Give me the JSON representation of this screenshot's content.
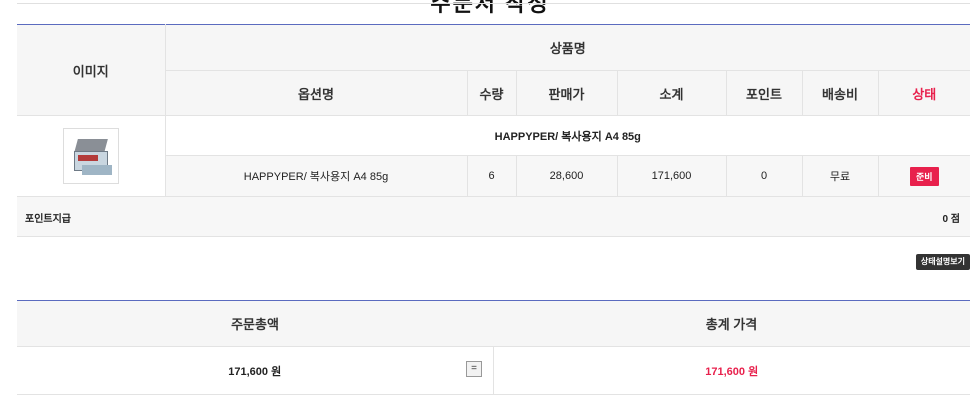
{
  "page": {
    "title": "주문서 작성"
  },
  "order_table": {
    "headers": {
      "image": "이미지",
      "product_name": "상품명",
      "option_name": "옵션명",
      "quantity": "수량",
      "price": "판매가",
      "subtotal": "소계",
      "point": "포인트",
      "shipping": "배송비",
      "status": "상태"
    },
    "items": [
      {
        "product_name": "HAPPYPER/ 복사용지 A4 85g",
        "option_name": "HAPPYPER/ 복사용지 A4 85g",
        "quantity": "6",
        "price": "28,600",
        "subtotal": "171,600",
        "point": "0",
        "shipping": "무료",
        "status": "준비",
        "image_icon": "copy-paper-box-thumbnail"
      }
    ]
  },
  "points": {
    "label": "포인트지급",
    "value": "0 점"
  },
  "status_description_button": "상태설명보기",
  "totals": {
    "order_total_label": "주문총액",
    "grand_total_label": "총계 가격",
    "order_total_value": "171,600 원",
    "operator": "=",
    "grand_total_value": "171,600 원"
  },
  "colors": {
    "accent_red": "#e8204c",
    "header_rule": "#5b6bbf",
    "header_bg": "#f6f6f6"
  }
}
